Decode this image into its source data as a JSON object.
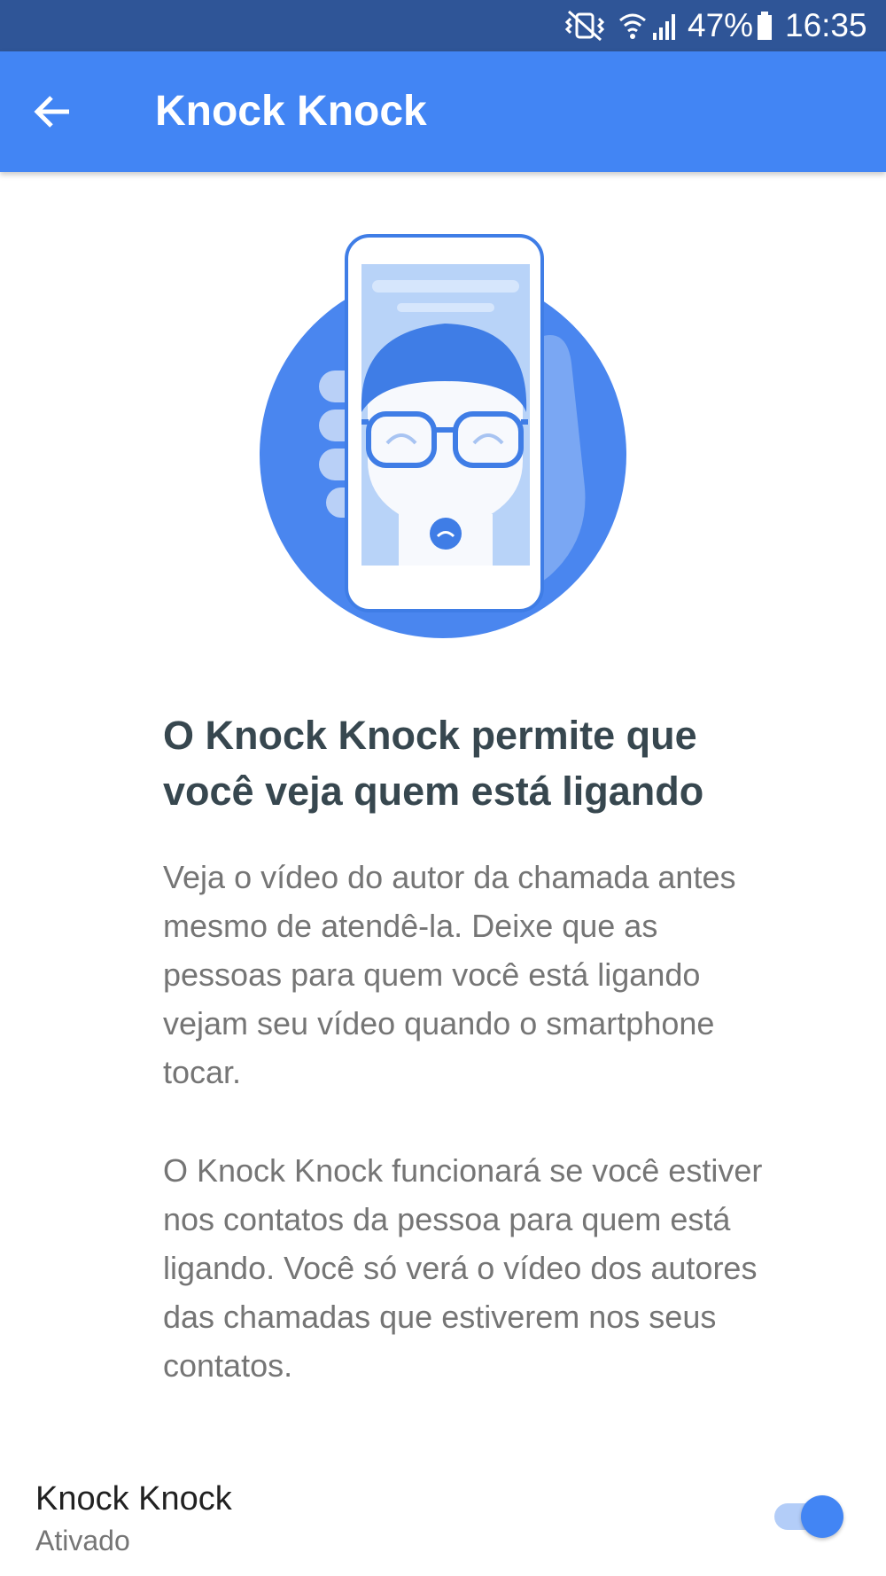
{
  "status_bar": {
    "battery": "47%",
    "time": "16:35",
    "icons": [
      "vibrate-mute-icon",
      "wifi-icon",
      "signal-icon",
      "battery-icon"
    ]
  },
  "app_bar": {
    "back_icon": "arrow-back-icon",
    "title": "Knock Knock"
  },
  "colors": {
    "status_bar": "#2f5597",
    "app_bar": "#4285f4",
    "accent": "#4285f4",
    "headline": "#37474f",
    "body": "#757575"
  },
  "content": {
    "headline": "O Knock Knock permite que você veja quem está ligando",
    "paragraph1": "Veja o vídeo do autor da chamada antes mesmo de atendê-la. Deixe que as pessoas para quem você está ligando vejam seu vídeo quando o smartphone tocar.",
    "paragraph2": "O Knock Knock funcionará se você estiver nos contatos da pessoa para quem está ligando. Você só verá o vídeo dos autores das chamadas que estiverem nos seus contatos."
  },
  "setting": {
    "title": "Knock Knock",
    "summary": "Ativado",
    "enabled": true
  }
}
